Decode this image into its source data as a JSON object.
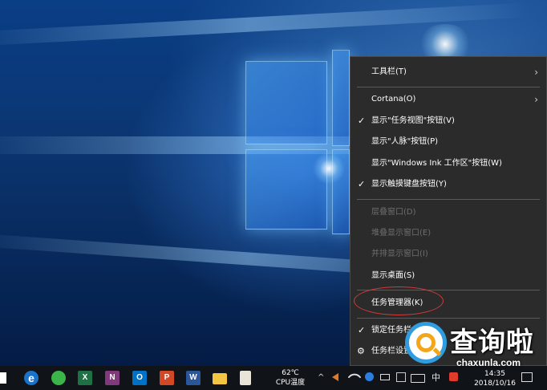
{
  "context_menu": {
    "items": [
      {
        "label": "工具栏(T)",
        "checked": false,
        "disabled": false,
        "submenu": true
      },
      {
        "label": "Cortana(O)",
        "checked": false,
        "disabled": false,
        "submenu": true
      },
      {
        "label": "显示\"任务视图\"按钮(V)",
        "checked": true,
        "disabled": false,
        "submenu": false
      },
      {
        "label": "显示\"人脉\"按钮(P)",
        "checked": false,
        "disabled": false,
        "submenu": false
      },
      {
        "label": "显示\"Windows Ink 工作区\"按钮(W)",
        "checked": false,
        "disabled": false,
        "submenu": false
      },
      {
        "label": "显示触摸键盘按钮(Y)",
        "checked": true,
        "disabled": false,
        "submenu": false
      },
      {
        "label": "层叠窗口(D)",
        "checked": false,
        "disabled": true,
        "submenu": false
      },
      {
        "label": "堆叠显示窗口(E)",
        "checked": false,
        "disabled": true,
        "submenu": false
      },
      {
        "label": "并排显示窗口(I)",
        "checked": false,
        "disabled": true,
        "submenu": false
      },
      {
        "label": "显示桌面(S)",
        "checked": false,
        "disabled": false,
        "submenu": false
      },
      {
        "label": "任务管理器(K)",
        "checked": false,
        "disabled": false,
        "submenu": false
      },
      {
        "label": "锁定任务栏",
        "checked": true,
        "disabled": false,
        "submenu": false
      },
      {
        "label": "任务栏设置",
        "checked": false,
        "disabled": false,
        "submenu": false
      }
    ],
    "check_glyph": "✓",
    "arrow_glyph": "›",
    "gear_glyph": "⚙",
    "highlight_color": "#d63a3a"
  },
  "taskbar": {
    "pinned_icons": [
      {
        "name": "windows-start-icon",
        "glyph": ""
      },
      {
        "name": "edge-browser-icon",
        "glyph": "e"
      },
      {
        "name": "green-app-icon",
        "glyph": ""
      },
      {
        "name": "excel-icon",
        "glyph": "X"
      },
      {
        "name": "onenote-icon",
        "glyph": "N"
      },
      {
        "name": "outlook-icon",
        "glyph": "O"
      },
      {
        "name": "powerpoint-icon",
        "glyph": "P"
      },
      {
        "name": "word-icon",
        "glyph": "W"
      },
      {
        "name": "file-explorer-icon",
        "glyph": ""
      },
      {
        "name": "notepad-icon",
        "glyph": ""
      }
    ],
    "cpu_temp_value": "62℃",
    "cpu_temp_label": "CPU温度",
    "tray": {
      "chevron": "^",
      "ime_label": "中",
      "clock_time": "14:35",
      "clock_date": "2018/10/16"
    }
  },
  "watermark": {
    "title": "查询啦",
    "domain": "chaxunla.com"
  }
}
